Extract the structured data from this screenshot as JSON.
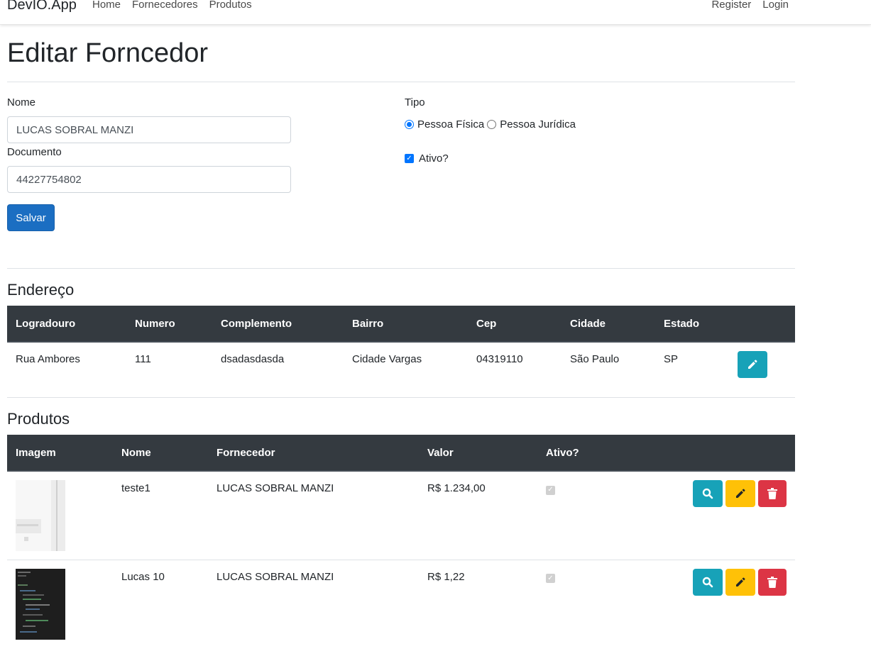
{
  "nav": {
    "brand": "DevIO.App",
    "links": [
      "Home",
      "Fornecedores",
      "Produtos"
    ],
    "right_links": [
      "Register",
      "Login"
    ]
  },
  "page_title": "Editar Forncedor",
  "form": {
    "nome_label": "Nome",
    "nome_value": "LUCAS SOBRAL MANZI",
    "documento_label": "Documento",
    "documento_value": "44227754802",
    "tipo_label": "Tipo",
    "tipo_options": [
      "Pessoa Física",
      "Pessoa Jurídica"
    ],
    "tipo_selected": "Pessoa Física",
    "ativo_label": "Ativo?",
    "ativo_checked": true,
    "save_label": "Salvar"
  },
  "endereco": {
    "title": "Endereço",
    "headers": [
      "Logradouro",
      "Numero",
      "Complemento",
      "Bairro",
      "Cep",
      "Cidade",
      "Estado"
    ],
    "row": [
      "Rua Ambores",
      "111",
      "dsadasdasda",
      "Cidade Vargas",
      "04319110",
      "São Paulo",
      "SP"
    ]
  },
  "produtos": {
    "title": "Produtos",
    "headers": [
      "Imagem",
      "Nome",
      "Fornecedor",
      "Valor",
      "Ativo?"
    ],
    "rows": [
      {
        "nome": "teste1",
        "fornecedor": "LUCAS SOBRAL MANZI",
        "valor": "R$ 1.234,00",
        "ativo": true,
        "image": "light-screenshot-thumbnail"
      },
      {
        "nome": "Lucas 10",
        "fornecedor": "LUCAS SOBRAL MANZI",
        "valor": "R$ 1,22",
        "ativo": true,
        "image": "dark-code-thumbnail"
      }
    ]
  },
  "colors": {
    "primary": "#1b6ec2",
    "table_header": "#343a40",
    "info": "#17a2b8",
    "warning": "#ffc107",
    "danger": "#dc3545"
  },
  "icons": {
    "edit": "pencil-icon",
    "details": "search-icon",
    "delete": "trash-icon"
  }
}
